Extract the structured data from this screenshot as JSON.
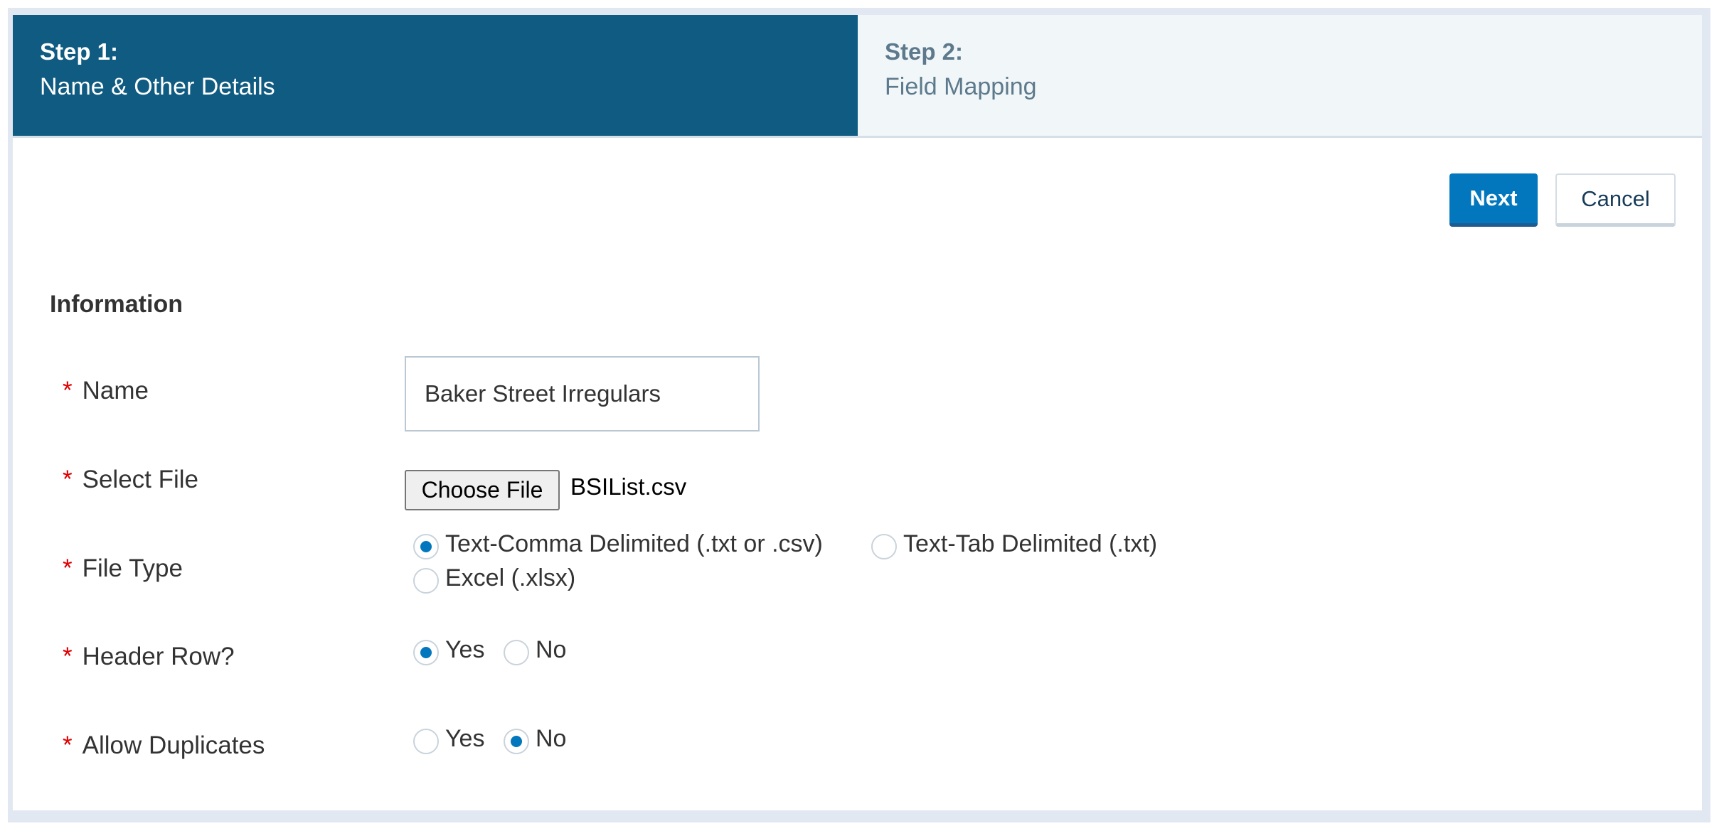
{
  "wizard": {
    "steps": [
      {
        "number": "Step 1:",
        "title": "Name & Other Details",
        "active": true
      },
      {
        "number": "Step 2:",
        "title": "Field Mapping",
        "active": false
      }
    ]
  },
  "actions": {
    "next_label": "Next",
    "cancel_label": "Cancel"
  },
  "form": {
    "section_title": "Information",
    "required_marker": "*",
    "name": {
      "label": "Name",
      "value": "Baker Street Irregulars"
    },
    "select_file": {
      "label": "Select File",
      "button_label": "Choose File",
      "file_name": "BSIList.csv"
    },
    "file_type": {
      "label": "File Type",
      "options": [
        {
          "label": "Text-Comma Delimited (.txt or .csv)",
          "checked": true
        },
        {
          "label": "Text-Tab Delimited (.txt)",
          "checked": false
        },
        {
          "label": "Excel (.xlsx)",
          "checked": false
        }
      ]
    },
    "header_row": {
      "label": "Header Row?",
      "options": [
        {
          "label": "Yes",
          "checked": true
        },
        {
          "label": "No",
          "checked": false
        }
      ]
    },
    "allow_duplicates": {
      "label": "Allow Duplicates",
      "options": [
        {
          "label": "Yes",
          "checked": false
        },
        {
          "label": "No",
          "checked": true
        }
      ]
    }
  },
  "colors": {
    "active_step_bg": "#0f5b81",
    "inactive_step_bg": "#f1f6f9",
    "primary_button": "#0277bd",
    "required_marker": "#e00000",
    "radio_selected": "#0277bd"
  }
}
